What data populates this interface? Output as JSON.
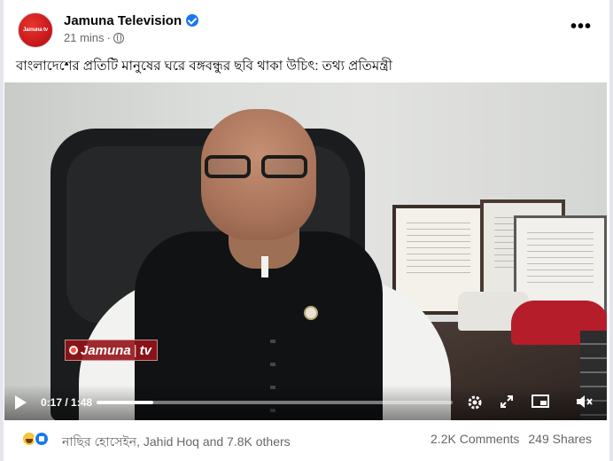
{
  "post": {
    "page_name": "Jamuna Television",
    "avatar_text": "Jamuna tv",
    "time": "21 mins",
    "separator": "·",
    "caption": "বাংলাদেশের প্রতিটি মানুষের ঘরে বঙ্গবন্ধুর ছবি থাকা উচিৎ: তথ্য প্রতিমন্ত্রী",
    "more_label": "•••"
  },
  "video": {
    "watermark": "Jamuna",
    "watermark_suffix": "tv",
    "time_display": "0:17 / 1:48",
    "progress": 0.16,
    "icons": {
      "play": "play-icon",
      "settings": "gear-icon",
      "expand": "expand-icon",
      "pip": "picture-in-picture-icon",
      "mute": "mute-icon"
    }
  },
  "footer": {
    "reactions_text": "নাছির হোসেইন, Jahid Hoq and 7.8K others",
    "comments": "2.2K Comments",
    "shares": "249 Shares"
  },
  "colors": {
    "brand_red": "#c4161c",
    "verified_blue": "#1877f2",
    "muted_text": "#65676b"
  }
}
